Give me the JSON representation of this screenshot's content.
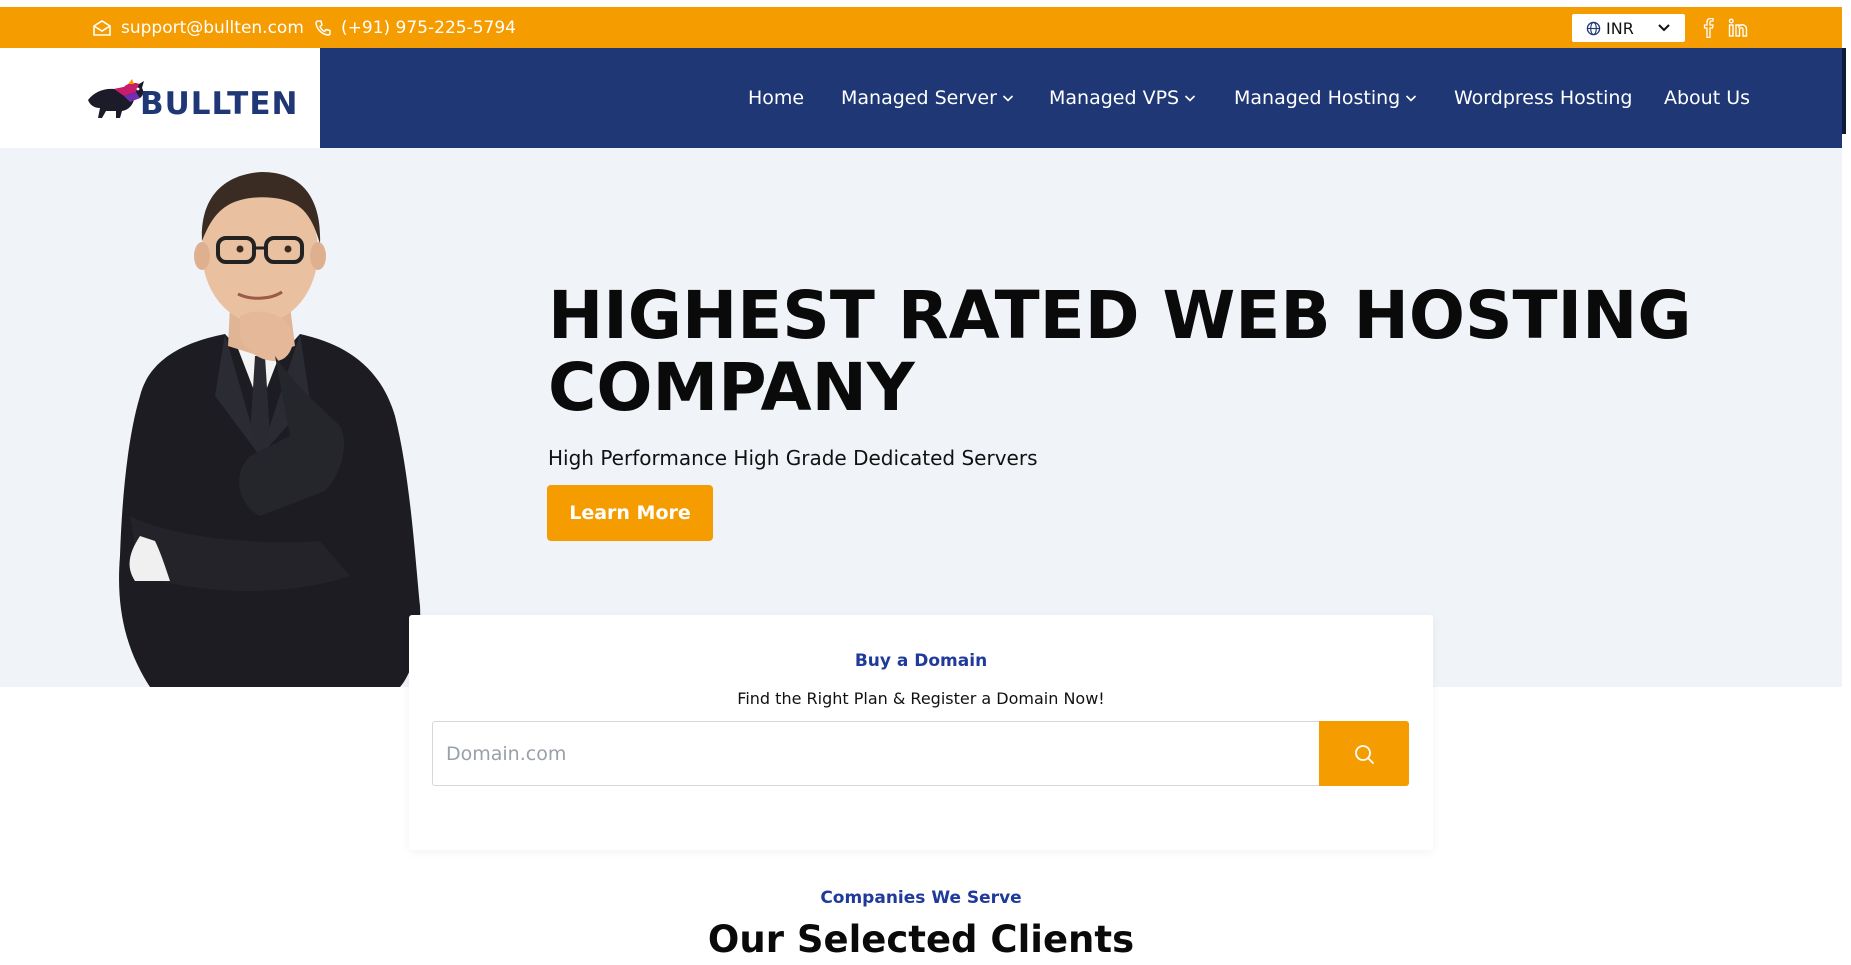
{
  "topbar": {
    "email": "support@bullten.com",
    "phone": "(+91) 975-225-5794",
    "currency": "INR",
    "icons": [
      "envelope-icon",
      "phone-icon",
      "globe-icon",
      "chevron-down-icon",
      "facebook-icon",
      "linkedin-icon"
    ]
  },
  "brand": {
    "name": "BULLTEN"
  },
  "nav": {
    "items": [
      {
        "label": "Home",
        "dropdown": false
      },
      {
        "label": "Managed Server",
        "dropdown": true
      },
      {
        "label": "Managed VPS",
        "dropdown": true
      },
      {
        "label": "Managed Hosting",
        "dropdown": true
      },
      {
        "label": "Wordpress Hosting",
        "dropdown": false
      },
      {
        "label": "About Us",
        "dropdown": false
      }
    ]
  },
  "hero": {
    "title_line1": "HIGHEST RATED WEB HOSTING",
    "title_line2": "COMPANY",
    "subtitle": "High Performance High Grade Dedicated Servers",
    "cta_label": "Learn More"
  },
  "domain": {
    "kicker": "Buy a Domain",
    "description": "Find the Right Plan & Register a Domain Now!",
    "placeholder": "Domain.com",
    "search_icon": "search-icon"
  },
  "clients": {
    "kicker": "Companies We Serve",
    "title": "Our Selected Clients"
  },
  "colors": {
    "accent": "#f59c00",
    "navy": "#1f3775",
    "hero_bg": "#f0f3f8",
    "kicker_blue": "#1f3a9a"
  }
}
